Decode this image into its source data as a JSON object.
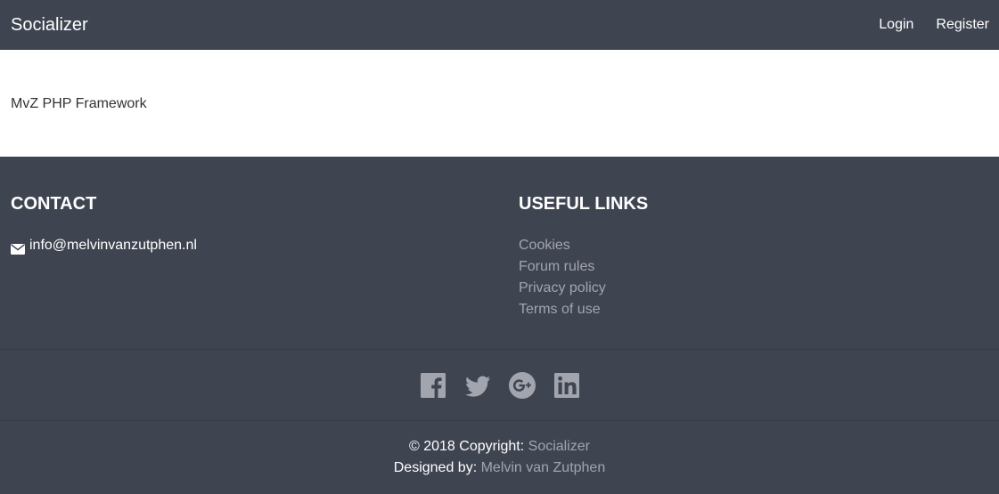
{
  "navbar": {
    "brand": "Socializer",
    "login_label": "Login",
    "register_label": "Register"
  },
  "main": {
    "text": "MvZ PHP Framework"
  },
  "footer": {
    "contact": {
      "heading": "CONTACT",
      "email": "info@melvinvanzutphen.nl",
      "icon": "envelope-icon"
    },
    "useful_links": {
      "heading": "USEFUL LINKS",
      "items": [
        {
          "label": "Cookies"
        },
        {
          "label": "Forum rules"
        },
        {
          "label": "Privacy policy"
        },
        {
          "label": "Terms of use"
        }
      ]
    },
    "social": {
      "icons": [
        "facebook-icon",
        "twitter-icon",
        "google-plus-icon",
        "linkedin-icon"
      ],
      "icon_color": "#a2a5ad"
    },
    "copyright": {
      "prefix": "© 2018 Copyright: ",
      "brand_link": "Socializer",
      "designed_prefix": "Designed by: ",
      "designer_link": "Melvin van Zutphen"
    }
  },
  "colors": {
    "background": "#3f4451",
    "muted_link": "#a2a5ad",
    "text": "#ffffff"
  }
}
